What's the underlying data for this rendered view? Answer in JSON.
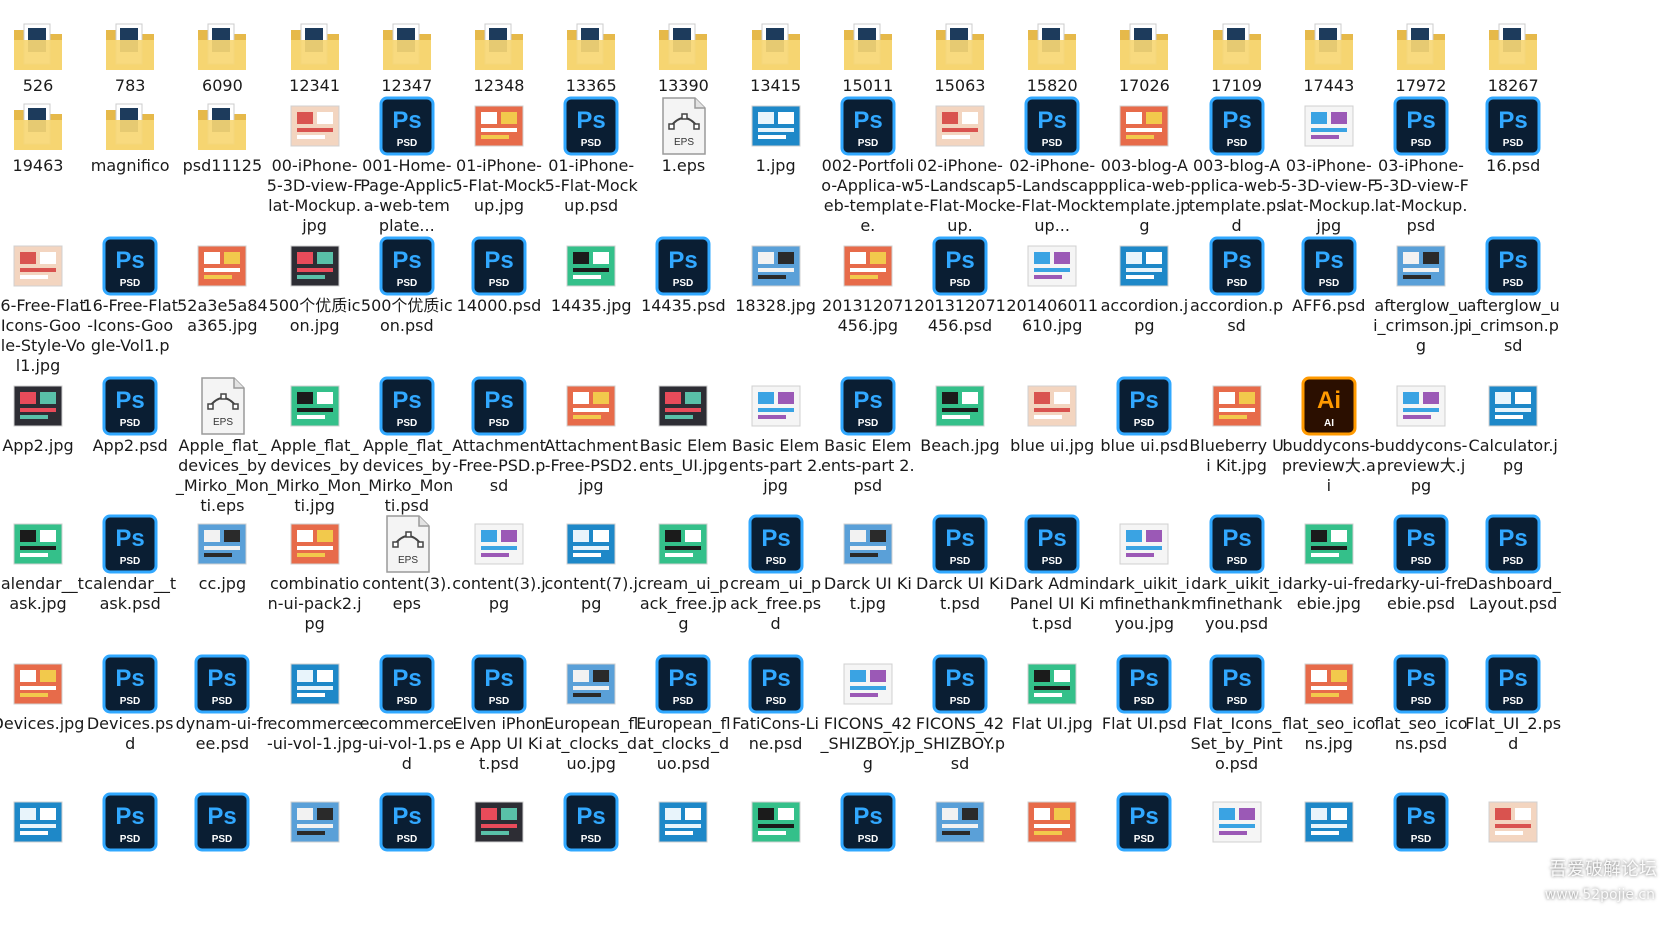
{
  "window": {
    "title": ""
  },
  "colors": {
    "ps_bg": "#0a1e33",
    "ps_border": "#31a8ff",
    "ps_text": "#31a8ff",
    "ai_bg": "#2b0f00",
    "ai_text": "#ff9a00",
    "folder": "#f7d774",
    "folder_dark": "#e6b94a"
  },
  "files": [
    {
      "label": "526",
      "icon": "folder-icon"
    },
    {
      "label": "783",
      "icon": "folder-icon"
    },
    {
      "label": "6090",
      "icon": "folder-icon"
    },
    {
      "label": "12341",
      "icon": "folder-icon"
    },
    {
      "label": "12347",
      "icon": "folder-icon"
    },
    {
      "label": "12348",
      "icon": "folder-icon"
    },
    {
      "label": "13365",
      "icon": "folder-icon"
    },
    {
      "label": "13390",
      "icon": "folder-icon"
    },
    {
      "label": "13415",
      "icon": "folder-icon"
    },
    {
      "label": "15011",
      "icon": "folder-icon"
    },
    {
      "label": "15063",
      "icon": "folder-icon"
    },
    {
      "label": "15820",
      "icon": "folder-icon"
    },
    {
      "label": "17026",
      "icon": "folder-icon"
    },
    {
      "label": "17109",
      "icon": "folder-icon"
    },
    {
      "label": "17443",
      "icon": "folder-icon"
    },
    {
      "label": "17972",
      "icon": "folder-icon"
    },
    {
      "label": "18267",
      "icon": "folder-icon"
    },
    {
      "label": "19463",
      "icon": "folder-icon"
    },
    {
      "label": "magnifico",
      "icon": "folder-icon"
    },
    {
      "label": "psd11125",
      "icon": "folder-icon"
    },
    {
      "label": "00-iPhone-5-3D-view-Flat-Mockup.jpg",
      "icon": "image-icon"
    },
    {
      "label": "001-Home-Page-Applica-web-template...",
      "icon": "photoshop-file-icon"
    },
    {
      "label": "01-iPhone-5-Flat-Mockup.jpg",
      "icon": "image-icon"
    },
    {
      "label": "01-iPhone-5-Flat-Mockup.psd",
      "icon": "photoshop-file-icon"
    },
    {
      "label": "1.eps",
      "icon": "eps-file-icon"
    },
    {
      "label": "1.jpg",
      "icon": "image-icon"
    },
    {
      "label": "002-Portfolio-Applica-web-template.",
      "icon": "photoshop-file-icon"
    },
    {
      "label": "02-iPhone-5-Landscape-Flat-Mockup.",
      "icon": "image-icon"
    },
    {
      "label": "02-iPhone-5-Landscape-Flat-Mockup...",
      "icon": "photoshop-file-icon"
    },
    {
      "label": "003-blog-Applica-web-template.jpg",
      "icon": "image-icon"
    },
    {
      "label": "003-blog-Applica-web-template.psd",
      "icon": "photoshop-file-icon"
    },
    {
      "label": "03-iPhone-5-3D-view-Flat-Mockup.jpg",
      "icon": "image-icon"
    },
    {
      "label": "03-iPhone-5-3D-view-Flat-Mockup.psd",
      "icon": "photoshop-file-icon"
    },
    {
      "label": "16.psd",
      "icon": "photoshop-file-icon"
    },
    {
      "label": "16-Free-Flat-Icons-Google-Style-Vol1.jpg",
      "icon": "image-icon"
    },
    {
      "label": "16-Free-Flat-Icons-Google-Vol1.p",
      "icon": "photoshop-file-icon"
    },
    {
      "label": "52a3e5a84a365.jpg",
      "icon": "image-icon"
    },
    {
      "label": "500个优质icon.jpg",
      "icon": "image-icon"
    },
    {
      "label": "500个优质icon.psd",
      "icon": "photoshop-file-icon"
    },
    {
      "label": "14000.psd",
      "icon": "photoshop-file-icon"
    },
    {
      "label": "14435.jpg",
      "icon": "image-icon"
    },
    {
      "label": "14435.psd",
      "icon": "photoshop-file-icon"
    },
    {
      "label": "18328.jpg",
      "icon": "image-icon"
    },
    {
      "label": "201312071456.jpg",
      "icon": "image-icon"
    },
    {
      "label": "201312071456.psd",
      "icon": "photoshop-file-icon"
    },
    {
      "label": "201406011610.jpg",
      "icon": "image-icon"
    },
    {
      "label": "accordion.jpg",
      "icon": "image-icon"
    },
    {
      "label": "accordion.psd",
      "icon": "photoshop-file-icon"
    },
    {
      "label": "AFF6.psd",
      "icon": "photoshop-file-icon"
    },
    {
      "label": "afterglow_ui_crimson.jpg",
      "icon": "image-icon"
    },
    {
      "label": "afterglow_ui_crimson.psd",
      "icon": "photoshop-file-icon"
    },
    {
      "label": "App2.jpg",
      "icon": "image-icon"
    },
    {
      "label": "App2.psd",
      "icon": "photoshop-file-icon"
    },
    {
      "label": "Apple_flat_devices_by_Mirko_Monti.eps",
      "icon": "eps-file-icon"
    },
    {
      "label": "Apple_flat_devices_by_Mirko_Monti.jpg",
      "icon": "image-icon"
    },
    {
      "label": "Apple_flat_devices_by_Mirko_Monti.psd",
      "icon": "photoshop-file-icon"
    },
    {
      "label": "Attachment-Free-PSD.psd",
      "icon": "photoshop-file-icon"
    },
    {
      "label": "Attachment-Free-PSD2.jpg",
      "icon": "image-icon"
    },
    {
      "label": "Basic Elements_UI.jpg",
      "icon": "image-icon"
    },
    {
      "label": "Basic Elements-part 2.jpg",
      "icon": "image-icon"
    },
    {
      "label": "Basic Elements-part 2.psd",
      "icon": "photoshop-file-icon"
    },
    {
      "label": "Beach.jpg",
      "icon": "image-icon"
    },
    {
      "label": "blue ui.jpg",
      "icon": "image-icon"
    },
    {
      "label": "blue ui.psd",
      "icon": "photoshop-file-icon"
    },
    {
      "label": "Blueberry Ui Kit.jpg",
      "icon": "image-icon"
    },
    {
      "label": "buddycons-preview大.ai",
      "icon": "illustrator-file-icon"
    },
    {
      "label": "buddycons-preview大.jpg",
      "icon": "image-icon"
    },
    {
      "label": "Calculator.jpg",
      "icon": "image-icon"
    },
    {
      "label": "calendar__task.jpg",
      "icon": "image-icon"
    },
    {
      "label": "calendar__task.psd",
      "icon": "photoshop-file-icon"
    },
    {
      "label": "cc.jpg",
      "icon": "image-icon"
    },
    {
      "label": "combination-ui-pack2.jpg",
      "icon": "image-icon"
    },
    {
      "label": "content(3).eps",
      "icon": "eps-file-icon"
    },
    {
      "label": "content(3).jpg",
      "icon": "image-icon"
    },
    {
      "label": "content(7).jpg",
      "icon": "image-icon"
    },
    {
      "label": "cream_ui_pack_free.jpg",
      "icon": "image-icon"
    },
    {
      "label": "cream_ui_pack_free.psd",
      "icon": "photoshop-file-icon"
    },
    {
      "label": "Darck UI Kit.jpg",
      "icon": "image-icon"
    },
    {
      "label": "Darck UI Kit.psd",
      "icon": "photoshop-file-icon"
    },
    {
      "label": "Dark Admin Panel UI Kit.psd",
      "icon": "photoshop-file-icon"
    },
    {
      "label": "dark_uikit_imfinethankyou.jpg",
      "icon": "image-icon"
    },
    {
      "label": "dark_uikit_imfinethankyou.psd",
      "icon": "photoshop-file-icon"
    },
    {
      "label": "darky-ui-freebie.jpg",
      "icon": "image-icon"
    },
    {
      "label": "darky-ui-freebie.psd",
      "icon": "photoshop-file-icon"
    },
    {
      "label": "Dashboard_Layout.psd",
      "icon": "photoshop-file-icon"
    },
    {
      "label": "Devices.jpg",
      "icon": "image-icon"
    },
    {
      "label": "Devices.psd",
      "icon": "photoshop-file-icon"
    },
    {
      "label": "dynam-ui-free.psd",
      "icon": "photoshop-file-icon"
    },
    {
      "label": "ecommerce-ui-vol-1.jpg",
      "icon": "image-icon"
    },
    {
      "label": "ecommerce-ui-vol-1.psd",
      "icon": "photoshop-file-icon"
    },
    {
      "label": "Elven iPhone App UI Kit.psd",
      "icon": "photoshop-file-icon"
    },
    {
      "label": "European_flat_clocks_duo.jpg",
      "icon": "image-icon"
    },
    {
      "label": "European_flat_clocks_duo.psd",
      "icon": "photoshop-file-icon"
    },
    {
      "label": "FatiCons-Line.psd",
      "icon": "photoshop-file-icon"
    },
    {
      "label": "FICONS_42_SHIZBOY.jpg",
      "icon": "image-icon"
    },
    {
      "label": "FICONS_42_SHIZBOY.psd",
      "icon": "photoshop-file-icon"
    },
    {
      "label": "Flat UI.jpg",
      "icon": "image-icon"
    },
    {
      "label": "Flat UI.psd",
      "icon": "photoshop-file-icon"
    },
    {
      "label": "Flat_Icons_Set_by_Pinto.psd",
      "icon": "photoshop-file-icon"
    },
    {
      "label": "flat_seo_icons.jpg",
      "icon": "image-icon"
    },
    {
      "label": "flat_seo_icons.psd",
      "icon": "photoshop-file-icon"
    },
    {
      "label": "Flat_UI_2.psd",
      "icon": "photoshop-file-icon"
    },
    {
      "label": "",
      "icon": "image-icon"
    },
    {
      "label": "",
      "icon": "photoshop-file-icon"
    },
    {
      "label": "",
      "icon": "photoshop-file-icon"
    },
    {
      "label": "",
      "icon": "image-icon"
    },
    {
      "label": "",
      "icon": "photoshop-file-icon"
    },
    {
      "label": "",
      "icon": "image-icon"
    },
    {
      "label": "",
      "icon": "photoshop-file-icon"
    },
    {
      "label": "",
      "icon": "image-icon"
    },
    {
      "label": "",
      "icon": "image-icon"
    },
    {
      "label": "",
      "icon": "photoshop-file-icon"
    },
    {
      "label": "",
      "icon": "image-icon"
    },
    {
      "label": "",
      "icon": "image-icon"
    },
    {
      "label": "",
      "icon": "photoshop-file-icon"
    },
    {
      "label": "",
      "icon": "image-icon"
    },
    {
      "label": "",
      "icon": "image-icon"
    },
    {
      "label": "",
      "icon": "photoshop-file-icon"
    },
    {
      "label": "",
      "icon": "image-icon"
    }
  ],
  "watermark": {
    "text": "吾爱破解论坛",
    "url": "www.52pojie.cn"
  }
}
